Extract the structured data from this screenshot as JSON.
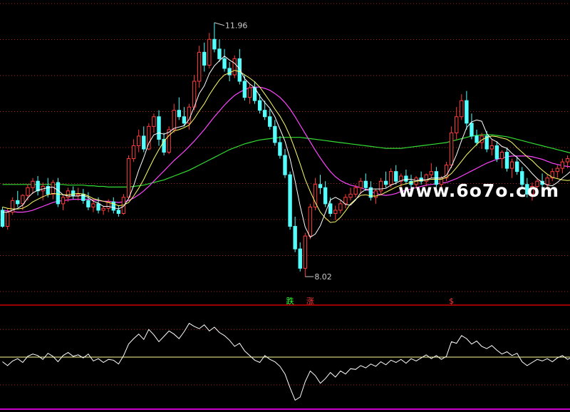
{
  "watermark": "www.6o7o.com",
  "chart_data": {
    "type": "candlestick",
    "high_annotation": "11.96",
    "low_annotation": "8.02",
    "ylim": [
      7.8,
      12.2
    ],
    "colors": {
      "up": "#ff3c3c",
      "down": "#54ffff",
      "ma5": "#ffffff",
      "ma10": "#ffff66",
      "ma20": "#ff44ff",
      "ma60": "#33dd33",
      "indicator": "#ffffff",
      "indicator_baseline": "#ffff99",
      "divider": "#cc0000",
      "grid": "#aa2222"
    },
    "signals": [
      {
        "index": 57,
        "text": "跌",
        "color": "#33ff33"
      },
      {
        "index": 61,
        "text": "涨",
        "color": "#ff3333"
      },
      {
        "index": 89,
        "text": "$",
        "color": "#ff3333"
      }
    ],
    "ohlc": [
      [
        9.05,
        9.1,
        8.78,
        8.8
      ],
      [
        8.8,
        9.08,
        8.75,
        9.02
      ],
      [
        9.02,
        9.25,
        8.98,
        9.2
      ],
      [
        9.2,
        9.35,
        9.1,
        9.15
      ],
      [
        9.15,
        9.3,
        9.05,
        9.28
      ],
      [
        9.28,
        9.45,
        9.2,
        9.4
      ],
      [
        9.4,
        9.55,
        9.3,
        9.5
      ],
      [
        9.5,
        9.58,
        9.28,
        9.35
      ],
      [
        9.35,
        9.48,
        9.2,
        9.42
      ],
      [
        9.42,
        9.55,
        9.25,
        9.3
      ],
      [
        9.3,
        9.52,
        9.22,
        9.48
      ],
      [
        9.48,
        9.55,
        9.1,
        9.15
      ],
      [
        9.15,
        9.3,
        9.05,
        9.25
      ],
      [
        9.25,
        9.4,
        9.18,
        9.35
      ],
      [
        9.35,
        9.42,
        9.22,
        9.28
      ],
      [
        9.28,
        9.4,
        9.2,
        9.3
      ],
      [
        9.3,
        9.38,
        9.15,
        9.2
      ],
      [
        9.2,
        9.33,
        9.05,
        9.1
      ],
      [
        9.1,
        9.22,
        9.02,
        9.15
      ],
      [
        9.15,
        9.25,
        9.0,
        9.05
      ],
      [
        9.05,
        9.12,
        8.98,
        9.08
      ],
      [
        9.08,
        9.22,
        9.02,
        9.18
      ],
      [
        9.18,
        9.25,
        9.0,
        9.05
      ],
      [
        9.05,
        9.12,
        8.95,
        9.0
      ],
      [
        9.0,
        9.3,
        8.98,
        9.25
      ],
      [
        9.25,
        9.9,
        9.22,
        9.85
      ],
      [
        9.85,
        10.15,
        9.8,
        10.05
      ],
      [
        10.05,
        10.3,
        9.95,
        10.2
      ],
      [
        10.2,
        10.35,
        9.95,
        10.0
      ],
      [
        10.0,
        10.4,
        9.98,
        10.35
      ],
      [
        10.35,
        10.55,
        10.25,
        10.5
      ],
      [
        10.5,
        10.6,
        10.05,
        10.15
      ],
      [
        10.15,
        10.25,
        9.9,
        9.95
      ],
      [
        9.95,
        10.35,
        9.92,
        10.3
      ],
      [
        10.3,
        10.7,
        10.25,
        10.6
      ],
      [
        10.6,
        10.8,
        10.45,
        10.5
      ],
      [
        10.5,
        10.65,
        10.35,
        10.4
      ],
      [
        10.4,
        10.7,
        10.3,
        10.65
      ],
      [
        10.65,
        11.15,
        10.6,
        11.05
      ],
      [
        11.05,
        11.6,
        10.95,
        11.5
      ],
      [
        11.5,
        11.65,
        11.2,
        11.3
      ],
      [
        11.3,
        11.8,
        11.25,
        11.7
      ],
      [
        11.7,
        11.96,
        11.5,
        11.55
      ],
      [
        11.55,
        11.7,
        11.35,
        11.4
      ],
      [
        11.4,
        11.55,
        11.2,
        11.25
      ],
      [
        11.25,
        11.35,
        11.05,
        11.15
      ],
      [
        11.15,
        11.45,
        11.1,
        11.4
      ],
      [
        11.4,
        11.55,
        11.0,
        11.05
      ],
      [
        11.05,
        11.15,
        10.75,
        10.8
      ],
      [
        10.8,
        11.0,
        10.7,
        10.95
      ],
      [
        10.95,
        11.05,
        10.7,
        10.75
      ],
      [
        10.75,
        10.85,
        10.55,
        10.6
      ],
      [
        10.6,
        10.75,
        10.45,
        10.5
      ],
      [
        10.5,
        10.62,
        10.3,
        10.35
      ],
      [
        10.35,
        10.45,
        10.05,
        10.1
      ],
      [
        10.1,
        10.2,
        9.85,
        9.9
      ],
      [
        9.9,
        10.0,
        9.55,
        9.6
      ],
      [
        9.6,
        9.65,
        8.75,
        8.8
      ],
      [
        8.8,
        8.95,
        8.4,
        8.45
      ],
      [
        8.45,
        8.55,
        8.1,
        8.15
      ],
      [
        8.15,
        8.7,
        8.02,
        8.65
      ],
      [
        8.65,
        9.15,
        8.6,
        9.1
      ],
      [
        9.1,
        9.55,
        9.05,
        9.45
      ],
      [
        9.45,
        9.6,
        9.3,
        9.4
      ],
      [
        9.4,
        9.5,
        9.1,
        9.15
      ],
      [
        9.15,
        9.25,
        8.95,
        9.0
      ],
      [
        9.0,
        9.12,
        8.9,
        9.05
      ],
      [
        9.05,
        9.2,
        9.0,
        9.15
      ],
      [
        9.15,
        9.3,
        9.08,
        9.25
      ],
      [
        9.25,
        9.4,
        9.2,
        9.3
      ],
      [
        9.3,
        9.45,
        9.25,
        9.4
      ],
      [
        9.4,
        9.55,
        9.3,
        9.5
      ],
      [
        9.5,
        9.62,
        9.35,
        9.4
      ],
      [
        9.4,
        9.5,
        9.2,
        9.25
      ],
      [
        9.25,
        9.38,
        9.15,
        9.35
      ],
      [
        9.35,
        9.55,
        9.3,
        9.5
      ],
      [
        9.5,
        9.65,
        9.4,
        9.45
      ],
      [
        9.45,
        9.7,
        9.4,
        9.65
      ],
      [
        9.65,
        9.75,
        9.45,
        9.5
      ],
      [
        9.5,
        9.62,
        9.4,
        9.58
      ],
      [
        9.58,
        9.68,
        9.45,
        9.5
      ],
      [
        9.5,
        9.6,
        9.35,
        9.45
      ],
      [
        9.45,
        9.58,
        9.4,
        9.55
      ],
      [
        9.55,
        9.65,
        9.45,
        9.5
      ],
      [
        9.5,
        9.62,
        9.42,
        9.6
      ],
      [
        9.6,
        9.78,
        9.55,
        9.65
      ],
      [
        9.65,
        9.72,
        9.4,
        9.45
      ],
      [
        9.45,
        9.58,
        9.35,
        9.55
      ],
      [
        9.55,
        9.8,
        9.5,
        9.75
      ],
      [
        9.75,
        10.35,
        9.7,
        10.25
      ],
      [
        10.25,
        10.65,
        10.15,
        10.5
      ],
      [
        10.5,
        10.85,
        10.45,
        10.75
      ],
      [
        10.75,
        10.9,
        10.3,
        10.4
      ],
      [
        10.4,
        10.55,
        10.15,
        10.2
      ],
      [
        10.2,
        10.3,
        10.05,
        10.1
      ],
      [
        10.1,
        10.25,
        10.0,
        10.2
      ],
      [
        10.2,
        10.28,
        9.95,
        10.0
      ],
      [
        10.0,
        10.15,
        9.9,
        10.05
      ],
      [
        10.05,
        10.12,
        9.8,
        9.85
      ],
      [
        9.85,
        9.98,
        9.7,
        9.95
      ],
      [
        9.95,
        10.02,
        9.65,
        9.7
      ],
      [
        9.7,
        9.85,
        9.55,
        9.8
      ],
      [
        9.8,
        9.88,
        9.6,
        9.65
      ],
      [
        9.65,
        9.72,
        9.4,
        9.45
      ],
      [
        9.45,
        9.55,
        9.25,
        9.3
      ],
      [
        9.3,
        9.48,
        9.2,
        9.42
      ],
      [
        9.42,
        9.55,
        9.35,
        9.5
      ],
      [
        9.5,
        9.62,
        9.4,
        9.45
      ],
      [
        9.45,
        9.6,
        9.4,
        9.55
      ],
      [
        9.55,
        9.7,
        9.5,
        9.65
      ],
      [
        9.65,
        9.75,
        9.55,
        9.7
      ],
      [
        9.7,
        9.85,
        9.62,
        9.8
      ],
      [
        9.8,
        9.9,
        9.7,
        9.85
      ]
    ],
    "ma5": [
      9.02,
      9.02,
      9.05,
      9.08,
      9.13,
      9.24,
      9.32,
      9.36,
      9.38,
      9.4,
      9.41,
      9.36,
      9.29,
      9.27,
      9.27,
      9.27,
      9.28,
      9.25,
      9.19,
      9.16,
      9.11,
      9.11,
      9.09,
      9.07,
      9.11,
      9.23,
      9.43,
      9.67,
      9.87,
      10.09,
      10.22,
      10.25,
      10.23,
      10.26,
      10.32,
      10.34,
      10.36,
      10.46,
      10.65,
      10.86,
      10.98,
      11.17,
      11.29,
      11.37,
      11.44,
      11.38,
      11.33,
      11.24,
      11.09,
      11.01,
      10.95,
      10.82,
      10.72,
      10.63,
      10.5,
      10.31,
      10.12,
      9.85,
      9.5,
      9.12,
      8.79,
      8.63,
      8.68,
      8.81,
      9.01,
      9.21,
      9.25,
      9.21,
      9.14,
      9.13,
      9.21,
      9.32,
      9.37,
      9.38,
      9.38,
      9.38,
      9.39,
      9.44,
      9.47,
      9.51,
      9.53,
      9.53,
      9.51,
      9.52,
      9.52,
      9.55,
      9.55,
      9.55,
      9.59,
      9.73,
      9.91,
      10.13,
      10.33,
      10.42,
      10.45,
      10.43,
      10.24,
      10.15,
      10.11,
      10.04,
      10.01,
      9.93,
      9.87,
      9.79,
      9.71,
      9.62,
      9.54,
      9.48,
      9.44,
      9.43,
      9.48,
      9.55,
      9.61,
      9.68
    ],
    "ma10": [
      9.1,
      9.08,
      9.07,
      9.07,
      9.08,
      9.12,
      9.18,
      9.22,
      9.26,
      9.29,
      9.31,
      9.3,
      9.29,
      9.29,
      9.3,
      9.31,
      9.3,
      9.27,
      9.23,
      9.21,
      9.19,
      9.17,
      9.15,
      9.12,
      9.13,
      9.17,
      9.27,
      9.39,
      9.53,
      9.69,
      9.85,
      9.99,
      10.12,
      10.21,
      10.28,
      10.3,
      10.33,
      10.37,
      10.47,
      10.59,
      10.7,
      10.84,
      10.96,
      11.07,
      11.15,
      11.18,
      11.22,
      11.2,
      11.15,
      11.1,
      11.04,
      10.96,
      10.85,
      10.74,
      10.62,
      10.51,
      10.37,
      10.2,
      9.99,
      9.77,
      9.53,
      9.34,
      9.17,
      9.02,
      8.93,
      8.86,
      8.87,
      8.94,
      9.04,
      9.15,
      9.22,
      9.28,
      9.29,
      9.27,
      9.27,
      9.29,
      9.33,
      9.37,
      9.41,
      9.44,
      9.46,
      9.48,
      9.5,
      9.51,
      9.52,
      9.53,
      9.53,
      9.53,
      9.56,
      9.62,
      9.71,
      9.81,
      9.91,
      9.99,
      10.07,
      10.14,
      10.18,
      10.2,
      10.19,
      10.17,
      10.15,
      10.1,
      10.02,
      9.95,
      9.88,
      9.82,
      9.74,
      9.67,
      9.61,
      9.56,
      9.54,
      9.52,
      9.51,
      9.52
    ],
    "ma20": [
      9.05,
      9.04,
      9.03,
      9.02,
      9.02,
      9.03,
      9.05,
      9.08,
      9.11,
      9.14,
      9.17,
      9.19,
      9.2,
      9.21,
      9.22,
      9.22,
      9.22,
      9.22,
      9.21,
      9.2,
      9.19,
      9.19,
      9.18,
      9.17,
      9.18,
      9.2,
      9.24,
      9.29,
      9.35,
      9.42,
      9.5,
      9.58,
      9.66,
      9.74,
      9.82,
      9.89,
      9.96,
      10.04,
      10.12,
      10.21,
      10.3,
      10.4,
      10.5,
      10.59,
      10.68,
      10.76,
      10.83,
      10.88,
      10.92,
      10.95,
      10.96,
      10.96,
      10.94,
      10.91,
      10.86,
      10.8,
      10.72,
      10.62,
      10.5,
      10.37,
      10.24,
      10.11,
      9.98,
      9.86,
      9.75,
      9.65,
      9.57,
      9.51,
      9.47,
      9.44,
      9.42,
      9.4,
      9.37,
      9.34,
      9.31,
      9.29,
      9.28,
      9.29,
      9.31,
      9.34,
      9.36,
      9.38,
      9.4,
      9.42,
      9.44,
      9.45,
      9.46,
      9.47,
      9.48,
      9.51,
      9.54,
      9.58,
      9.62,
      9.66,
      9.7,
      9.74,
      9.78,
      9.81,
      9.84,
      9.86,
      9.88,
      9.89,
      9.89,
      9.89,
      9.89,
      9.88,
      9.86,
      9.84,
      9.81,
      9.78,
      9.76,
      9.74,
      9.73,
      9.72
    ],
    "ma60": [
      9.45,
      9.45,
      9.45,
      9.45,
      9.45,
      9.45,
      9.45,
      9.45,
      9.45,
      9.45,
      9.45,
      9.45,
      9.45,
      9.44,
      9.44,
      9.44,
      9.44,
      9.43,
      9.43,
      9.42,
      9.42,
      9.41,
      9.41,
      9.41,
      9.41,
      9.41,
      9.42,
      9.43,
      9.44,
      9.46,
      9.48,
      9.5,
      9.52,
      9.55,
      9.58,
      9.61,
      9.64,
      9.67,
      9.71,
      9.75,
      9.79,
      9.83,
      9.87,
      9.91,
      9.95,
      9.99,
      10.02,
      10.05,
      10.08,
      10.1,
      10.12,
      10.14,
      10.15,
      10.16,
      10.17,
      10.18,
      10.18,
      10.18,
      10.18,
      10.18,
      10.17,
      10.16,
      10.15,
      10.14,
      10.13,
      10.12,
      10.11,
      10.1,
      10.09,
      10.08,
      10.07,
      10.06,
      10.05,
      10.04,
      10.03,
      10.02,
      10.01,
      10.01,
      10.01,
      10.01,
      10.02,
      10.03,
      10.04,
      10.05,
      10.06,
      10.07,
      10.08,
      10.09,
      10.1,
      10.12,
      10.14,
      10.16,
      10.18,
      10.2,
      10.21,
      10.22,
      10.22,
      10.22,
      10.21,
      10.2,
      10.19,
      10.17,
      10.15,
      10.13,
      10.11,
      10.09,
      10.07,
      10.05,
      10.03,
      10.01,
      9.99,
      9.97,
      9.95,
      9.93
    ],
    "indicator": [
      -0.3,
      -0.55,
      -0.25,
      -0.1,
      -0.35,
      0.05,
      0.2,
      0.1,
      -0.15,
      0.25,
      0.05,
      -0.3,
      0.1,
      0.3,
      0.05,
      0.15,
      -0.05,
      0.2,
      -0.25,
      -0.1,
      -0.35,
      -0.15,
      -0.2,
      -0.45,
      0.1,
      0.85,
      1.2,
      1.5,
      1.15,
      1.8,
      1.45,
      1.0,
      1.35,
      1.7,
      1.5,
      1.2,
      1.65,
      2.2,
      2.0,
      1.85,
      2.1,
      1.7,
      1.95,
      1.6,
      1.4,
      1.1,
      0.7,
      0.9,
      0.4,
      0.1,
      -0.2,
      -0.35,
      0.1,
      -0.15,
      -0.3,
      -0.6,
      -1.1,
      -2.0,
      -2.8,
      -2.6,
      -1.6,
      -0.9,
      -1.2,
      -1.7,
      -1.4,
      -1.0,
      -1.3,
      -0.9,
      -1.1,
      -0.75,
      -0.8,
      -0.55,
      -0.7,
      -0.45,
      -0.6,
      -0.3,
      -0.5,
      -0.2,
      -0.35,
      -0.15,
      -0.4,
      -0.1,
      -0.25,
      -0.05,
      0.15,
      -0.1,
      0.1,
      -0.15,
      0.05,
      1.0,
      0.9,
      1.4,
      1.2,
      0.85,
      1.05,
      0.7,
      0.55,
      0.75,
      0.45,
      0.2,
      0.35,
      0.1,
      0.25,
      -0.3,
      -0.55,
      -0.35,
      -0.15,
      -0.25,
      -0.1,
      -0.3,
      -0.05,
      0.1,
      -0.15,
      0.0
    ]
  }
}
